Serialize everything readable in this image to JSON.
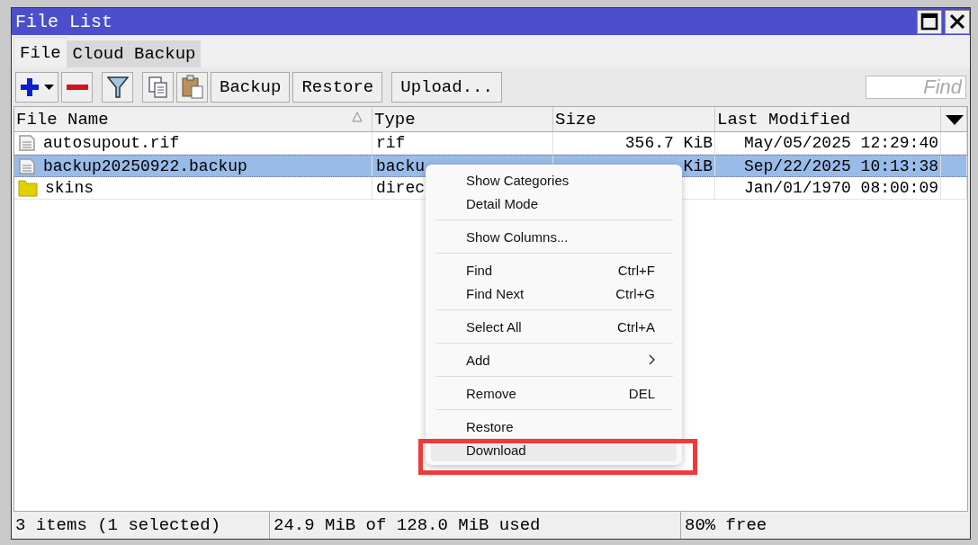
{
  "window": {
    "title": "File List"
  },
  "tabs": [
    {
      "label": "File",
      "selected": true
    },
    {
      "label": "Cloud Backup",
      "selected": false
    }
  ],
  "toolbar": {
    "buttons": [
      "Backup",
      "Restore",
      "Upload..."
    ],
    "find": {
      "placeholder": "Find"
    }
  },
  "table": {
    "columns": [
      {
        "label": "File Name",
        "sorted": true
      },
      {
        "label": "Type",
        "sorted": false
      },
      {
        "label": "Size",
        "sorted": false
      },
      {
        "label": "Last Modified",
        "sorted": false
      }
    ],
    "rows": [
      {
        "kind": "file",
        "name": "autosupout.rif",
        "type": "rif",
        "size": "356.7 KiB",
        "modified": "May/05/2025 12:29:40",
        "selected": false
      },
      {
        "kind": "file",
        "name": "backup20250922.backup",
        "type": "backu",
        "size": "KiB",
        "modified": "Sep/22/2025 10:13:38",
        "selected": true
      },
      {
        "kind": "folder",
        "name": "skins",
        "type": "direc",
        "modified": "Jan/01/1970 08:00:09",
        "selected": false
      }
    ]
  },
  "context_menu": {
    "items": [
      {
        "kind": "item",
        "label": "Show Categories",
        "hovered": false
      },
      {
        "kind": "item",
        "label": "Detail Mode",
        "hovered": false
      },
      {
        "kind": "separator"
      },
      {
        "kind": "item",
        "label": "Show Columns...",
        "hovered": false
      },
      {
        "kind": "separator"
      },
      {
        "kind": "item",
        "label": "Find",
        "shortcut": "Ctrl+F",
        "hovered": false
      },
      {
        "kind": "item",
        "label": "Find Next",
        "shortcut": "Ctrl+G",
        "hovered": false
      },
      {
        "kind": "separator"
      },
      {
        "kind": "item",
        "label": "Select All",
        "shortcut": "Ctrl+A",
        "hovered": false
      },
      {
        "kind": "separator"
      },
      {
        "kind": "submenu",
        "label": "Add",
        "hovered": false
      },
      {
        "kind": "separator"
      },
      {
        "kind": "item",
        "label": "Remove",
        "shortcut": "DEL",
        "hovered": false
      },
      {
        "kind": "separator"
      },
      {
        "kind": "item",
        "label": "Restore",
        "hovered": false
      },
      {
        "kind": "item",
        "label": "Download",
        "hovered": true,
        "highlighted": true
      }
    ]
  },
  "status_bar": [
    "3 items (1 selected)",
    "24.9 MiB of 128.0 MiB used",
    "80% free"
  ]
}
